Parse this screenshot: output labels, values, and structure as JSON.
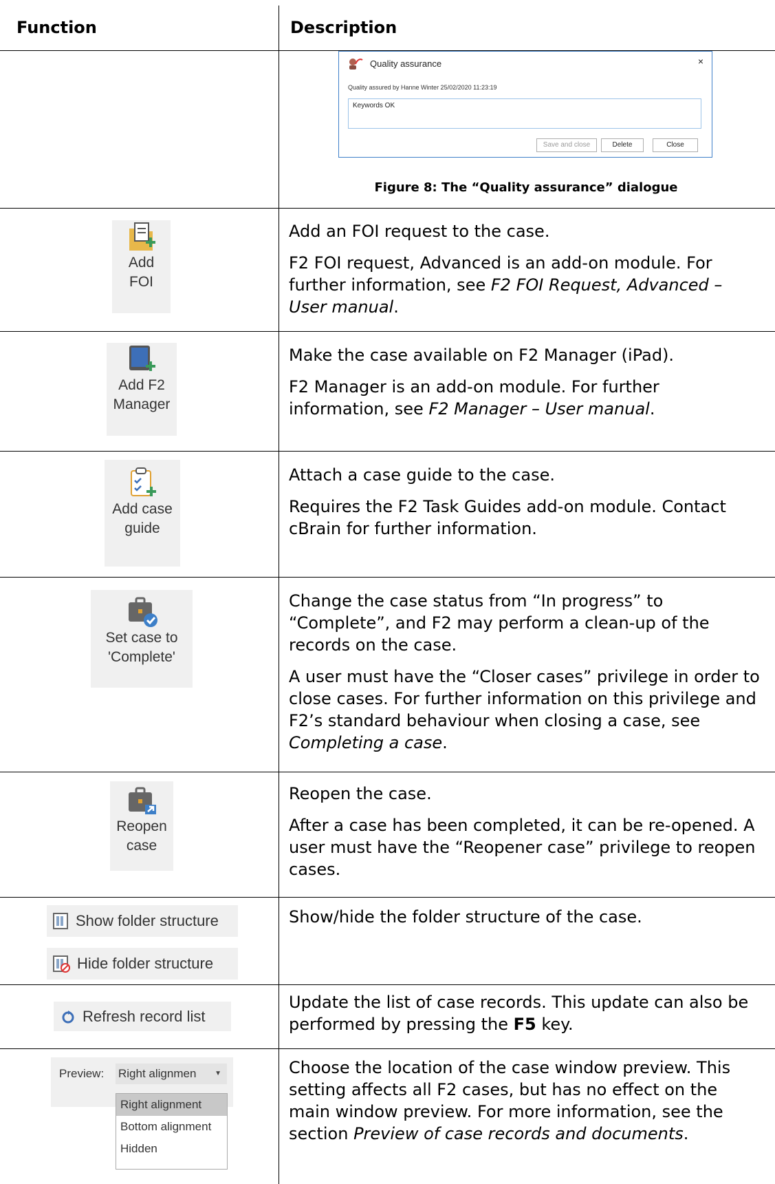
{
  "header": {
    "function": "Function",
    "description": "Description"
  },
  "dialog": {
    "title": "Quality assurance",
    "close": "×",
    "info": "Quality assured by Hanne Winter 25/02/2020 11:23:19",
    "text": "Keywords OK",
    "buttons": {
      "save_close": "Save and close",
      "delete": "Delete",
      "close": "Close"
    },
    "caption": "Figure 8: The “Quality assurance” dialogue"
  },
  "rows": {
    "add_foi": {
      "btn1": "Add",
      "btn2": "FOI",
      "p1": "Add an FOI request to the case.",
      "p2_a": "F2 FOI request, Advanced is an add-on module. For further information, see ",
      "p2_em": "F2 FOI Request, Advanced – User manual",
      "p2_b": "."
    },
    "add_manager": {
      "btn1": "Add F2",
      "btn2": "Manager",
      "p1": "Make the case available on F2 Manager (iPad).",
      "p2_a": "F2 Manager is an add-on module. For further information, see ",
      "p2_em": "F2 Manager – User manual",
      "p2_b": "."
    },
    "add_guide": {
      "btn1": "Add case",
      "btn2": "guide",
      "p1": "Attach a case guide to the case.",
      "p2": "Requires the F2 Task Guides add-on module. Contact cBrain for further information."
    },
    "complete": {
      "btn1": "Set case to",
      "btn2": "'Complete'",
      "p1": "Change the case status from “In progress” to “Complete”, and F2 may perform a clean-up of the records on the case.",
      "p2_a": "A user must have the “Closer cases” privilege in order to close cases. For further information on this privilege and F2’s standard behaviour when closing a case, see ",
      "p2_em": "Completing a case",
      "p2_b": "."
    },
    "reopen": {
      "btn1": "Reopen",
      "btn2": "case",
      "p1": "Reopen the case.",
      "p2": "After a case has been completed, it can be re-opened. A user must have the “Reopener case” privilege to reopen cases."
    },
    "folder": {
      "show": "Show folder structure",
      "hide": "Hide folder structure",
      "p1": "Show/hide the folder structure of the case."
    },
    "refresh": {
      "btn": "Refresh record list",
      "p1_a": "Update the list of case records. This update can also be performed by pressing the ",
      "p1_b": "F5",
      "p1_c": " key."
    },
    "preview": {
      "label": "Preview:",
      "value": "Right alignmen",
      "options": [
        "Right alignment",
        "Bottom alignment",
        "Hidden"
      ],
      "p1_a": "Choose the location of the case window preview. This setting affects all F2 cases, but has no effect on the main window preview. For more information, see the section ",
      "p1_em": "Preview of case records and documents",
      "p1_b": "."
    }
  }
}
